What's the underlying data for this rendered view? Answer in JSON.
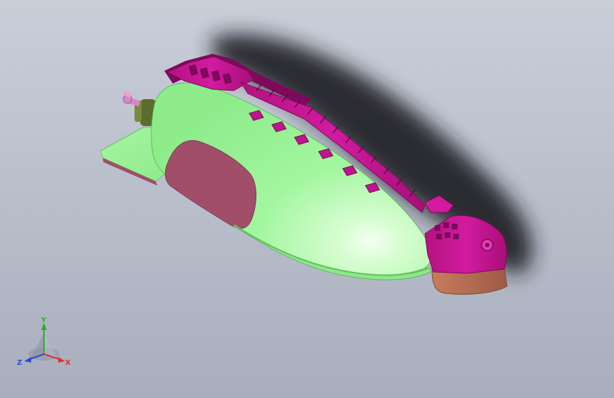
{
  "viewport": {
    "background_top": "#c9ced9",
    "background_bottom": "#a9aebd"
  },
  "model": {
    "body_color": "#9cf59a",
    "body_highlight": "#f4fff2",
    "frame_color": "#c0148e",
    "frame_dark": "#7d0a5c",
    "cutout_color": "#a04e6a",
    "base_color": "#b46d53",
    "shaft_color": "#5c6b2e",
    "knob_color": "#d889c4",
    "shadow_color": "#1c1c24"
  },
  "triad": {
    "x_label": "X",
    "y_label": "Y",
    "z_label": "Z",
    "x_color": "#e03030",
    "y_color": "#28b028",
    "z_color": "#2e49d8"
  }
}
